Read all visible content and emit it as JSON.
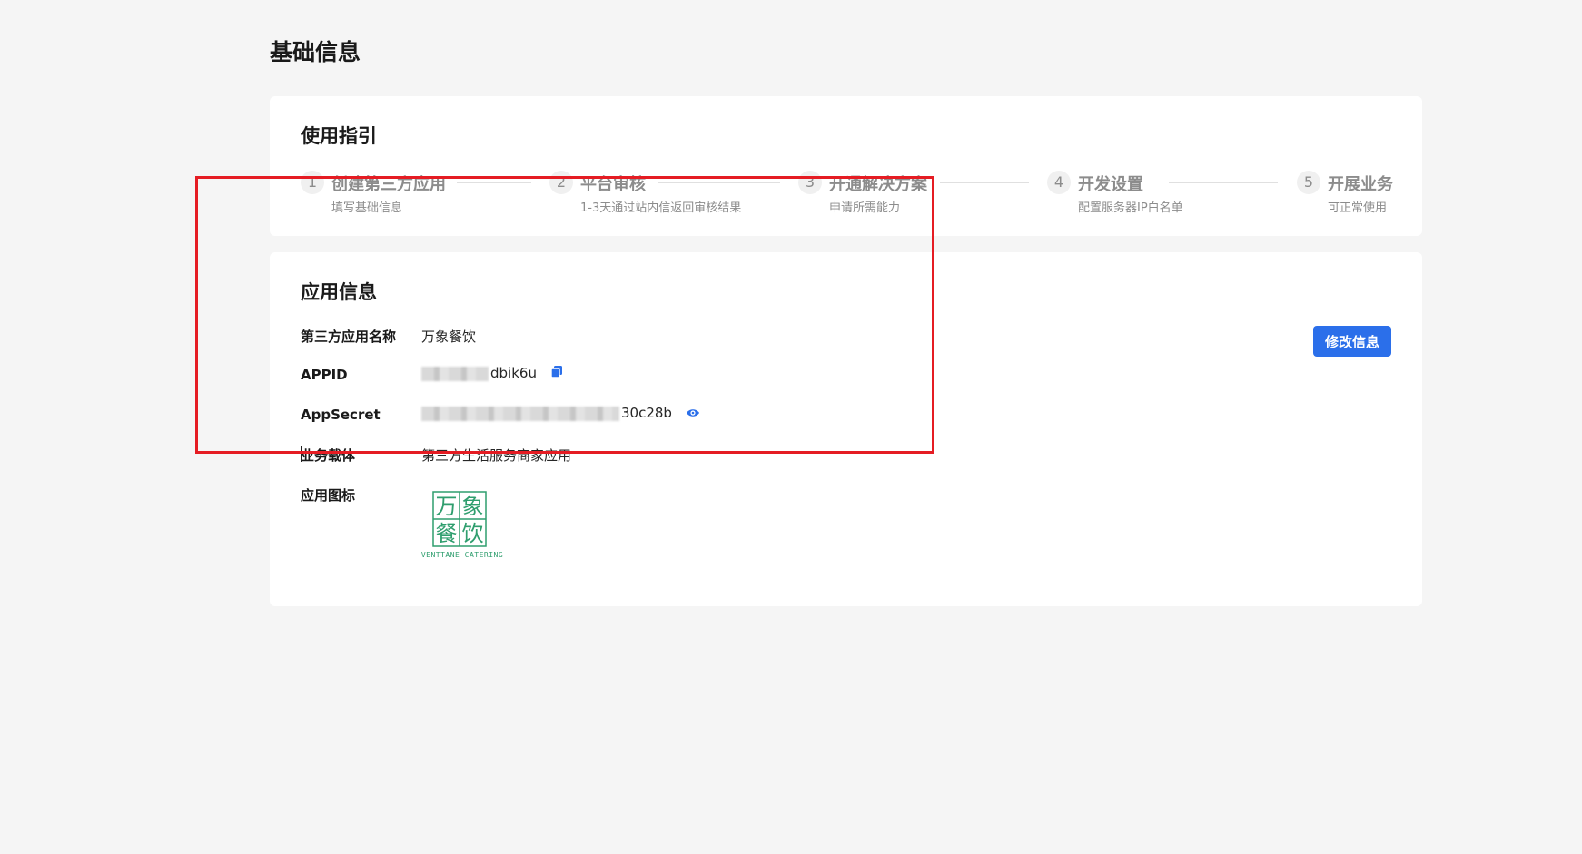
{
  "page": {
    "title": "基础信息"
  },
  "guide": {
    "title": "使用指引",
    "steps": [
      {
        "num": "1",
        "label": "创建第三方应用",
        "sub": "填写基础信息"
      },
      {
        "num": "2",
        "label": "平台审核",
        "sub": "1-3天通过站内信返回审核结果"
      },
      {
        "num": "3",
        "label": "开通解决方案",
        "sub": "申请所需能力"
      },
      {
        "num": "4",
        "label": "开发设置",
        "sub": "配置服务器IP白名单"
      },
      {
        "num": "5",
        "label": "开展业务",
        "sub": "可正常使用"
      }
    ]
  },
  "app_info": {
    "title": "应用信息",
    "edit_button": "修改信息",
    "rows": {
      "name": {
        "label": "第三方应用名称",
        "value": "万象餐饮"
      },
      "appid": {
        "label": "APPID",
        "value_suffix": "dbik6u"
      },
      "secret": {
        "label": "AppSecret",
        "value_suffix": "30c28b"
      },
      "carrier": {
        "label": "业务载体",
        "value": "第三方生活服务商家应用"
      },
      "icon": {
        "label": "应用图标"
      }
    },
    "logo": {
      "chars": [
        "万",
        "象",
        "餐",
        "饮"
      ],
      "caption": "VENTTANE CATERING",
      "color": "#2f9e6e"
    }
  },
  "colors": {
    "primary": "#2b6fea",
    "highlight_box": "#e51c23"
  }
}
